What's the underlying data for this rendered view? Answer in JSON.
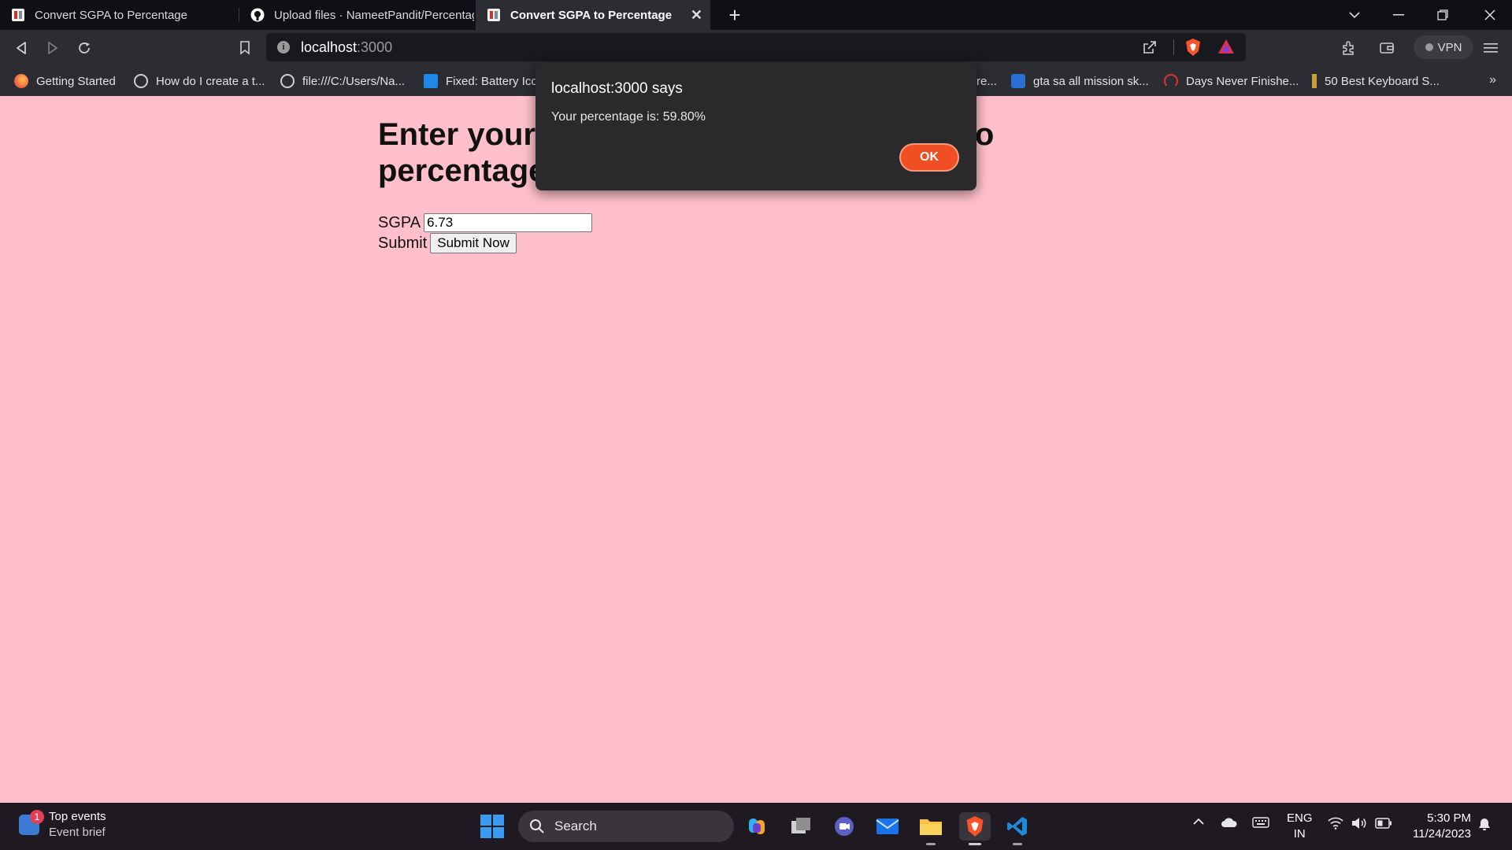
{
  "browser": {
    "tabs": [
      {
        "title": "Convert SGPA to Percentage",
        "active": false
      },
      {
        "title": "Upload files · NameetPandit/Percentag",
        "active": false
      },
      {
        "title": "Convert SGPA to Percentage",
        "active": true
      }
    ],
    "url_host": "localhost",
    "url_port": ":3000",
    "vpn_label": "VPN",
    "bookmarks": [
      "Getting Started",
      "How do I create a t...",
      "file:///C:/Users/Na...",
      "Fixed: Battery Ico",
      "re...",
      "gta sa all mission sk...",
      "Days Never Finishe...",
      "50 Best Keyboard S..."
    ],
    "more_label": "»"
  },
  "page": {
    "heading": "Enter your SGPA and we will convert it to percentage",
    "sgpa_label": "SGPA",
    "sgpa_value": "6.73",
    "submit_label": "Submit",
    "submit_button": "Submit Now"
  },
  "alert": {
    "title": "localhost:3000 says",
    "message": "Your percentage is: 59.80%",
    "ok_label": "OK"
  },
  "taskbar": {
    "weather_badge": "1",
    "weather_title": "Top events",
    "weather_sub": "Event brief",
    "search_label": "Search",
    "lang_top": "ENG",
    "lang_bottom": "IN",
    "time": "5:30 PM",
    "date": "11/24/2023"
  },
  "colors": {
    "page_bg": "#ffc0cb",
    "ok_button": "#f04e23",
    "chrome_dark": "#2b2d33"
  }
}
